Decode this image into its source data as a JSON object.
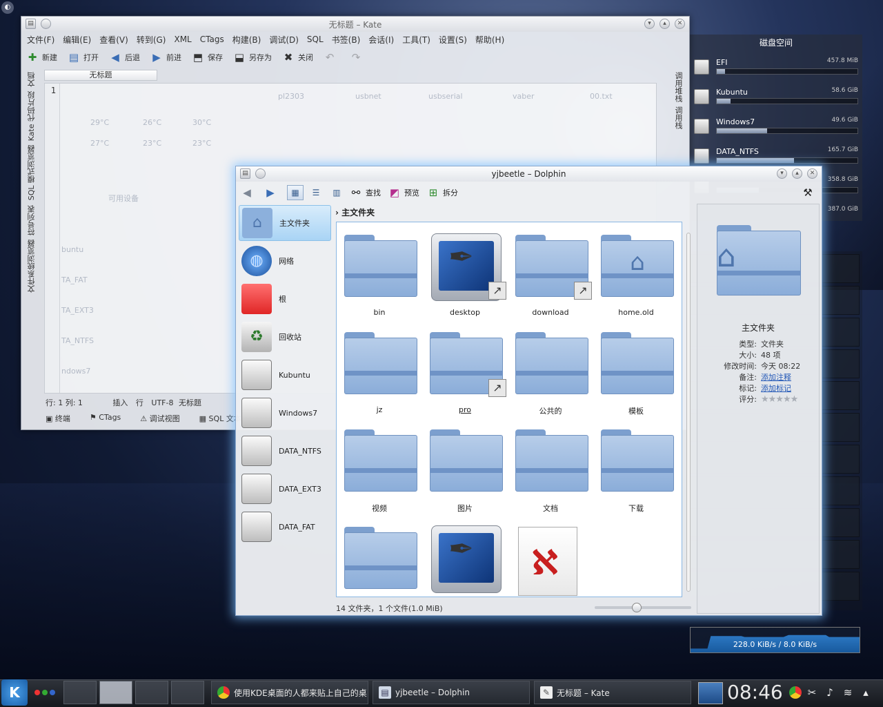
{
  "kate": {
    "title": "无标题 – Kate",
    "menu": [
      "文件(F)",
      "编辑(E)",
      "查看(V)",
      "转到(G)",
      "XML",
      "CTags",
      "构建(B)",
      "调试(D)",
      "SQL",
      "书签(B)",
      "会话(I)",
      "工具(T)",
      "设置(S)",
      "帮助(H)"
    ],
    "toolbar": {
      "new": "新建",
      "open": "打开",
      "back": "后退",
      "forward": "前进",
      "save": "保存",
      "saveas": "另存为",
      "close": "关闭"
    },
    "left_tabs": [
      "文档",
      "Kate 代码片段",
      "SQL 模式浏览器",
      "符号列表",
      "文件系统浏览器"
    ],
    "right_tabs": [
      "调用堆栈",
      "调用栈"
    ],
    "doc_tab": "无标题",
    "line_number": "1",
    "status": {
      "pos": "行: 1 列: 1",
      "mode": "插入",
      "row": "行",
      "encoding": "UTF-8",
      "file": "无标题"
    },
    "bottom_tools": [
      "终端",
      "CTags",
      "调试视图",
      "SQL 文本结"
    ],
    "ghost_text": {
      "files": [
        "pl2303",
        "usbnet",
        "usbserial",
        "vaber",
        "00.txt"
      ],
      "temps1": [
        "29°C",
        "26°C",
        "30°C"
      ],
      "temps2": [
        "27°C",
        "23°C",
        "23°C"
      ],
      "devices_title": "可用设备",
      "devices": [
        "buntu",
        "TA_FAT",
        "TA_EXT3",
        "TA_NTFS",
        "ndows7"
      ]
    }
  },
  "disk": {
    "title": "磁盘空间",
    "items": [
      {
        "name": "EFI",
        "size": "457.8 MiB",
        "fill": 0.06
      },
      {
        "name": "Kubuntu",
        "size": "58.6 GiB",
        "fill": 0.1
      },
      {
        "name": "Windows7",
        "size": "49.6 GiB",
        "fill": 0.36
      },
      {
        "name": "DATA_NTFS",
        "size": "165.7 GiB",
        "fill": 0.55
      },
      {
        "name": "",
        "size": "358.8 GiB",
        "fill": 0.3
      },
      {
        "name": "",
        "size": "387.0 GiB",
        "fill": 0.3
      }
    ]
  },
  "network": {
    "rate": "228.0 KiB/s / 8.0 KiB/s"
  },
  "dolphin": {
    "title": "yjbeetle – Dolphin",
    "toolbar": {
      "find": "查找",
      "preview": "预览",
      "split": "拆分"
    },
    "places": [
      "主文件夹",
      "网络",
      "根",
      "回收站",
      "Kubuntu",
      "Windows7",
      "DATA_NTFS",
      "DATA_EXT3",
      "DATA_FAT"
    ],
    "breadcrumb": "主文件夹",
    "files": [
      "bin",
      "desktop",
      "download",
      "home.old",
      "jz",
      "pro",
      "公共的",
      "模板",
      "视频",
      "图片",
      "文档",
      "下载",
      "",
      ""
    ],
    "status": "14 文件夹，1 个文件(1.0 MiB)",
    "info": {
      "title": "主文件夹",
      "type_k": "类型:",
      "type_v": "文件夹",
      "size_k": "大小:",
      "size_v": "48 项",
      "mtime_k": "修改时间:",
      "mtime_v": "今天 08:22",
      "note_k": "备注:",
      "note_v": "添加注释",
      "tag_k": "标记:",
      "tag_v": "添加标记",
      "rating_k": "评分:",
      "rating_stars": "★★★★★"
    }
  },
  "taskbar": {
    "tasks": [
      "使用KDE桌面的人都来贴上自己的桌",
      "yjbeetle – Dolphin",
      "无标题 – Kate"
    ],
    "clock": "08:46"
  }
}
